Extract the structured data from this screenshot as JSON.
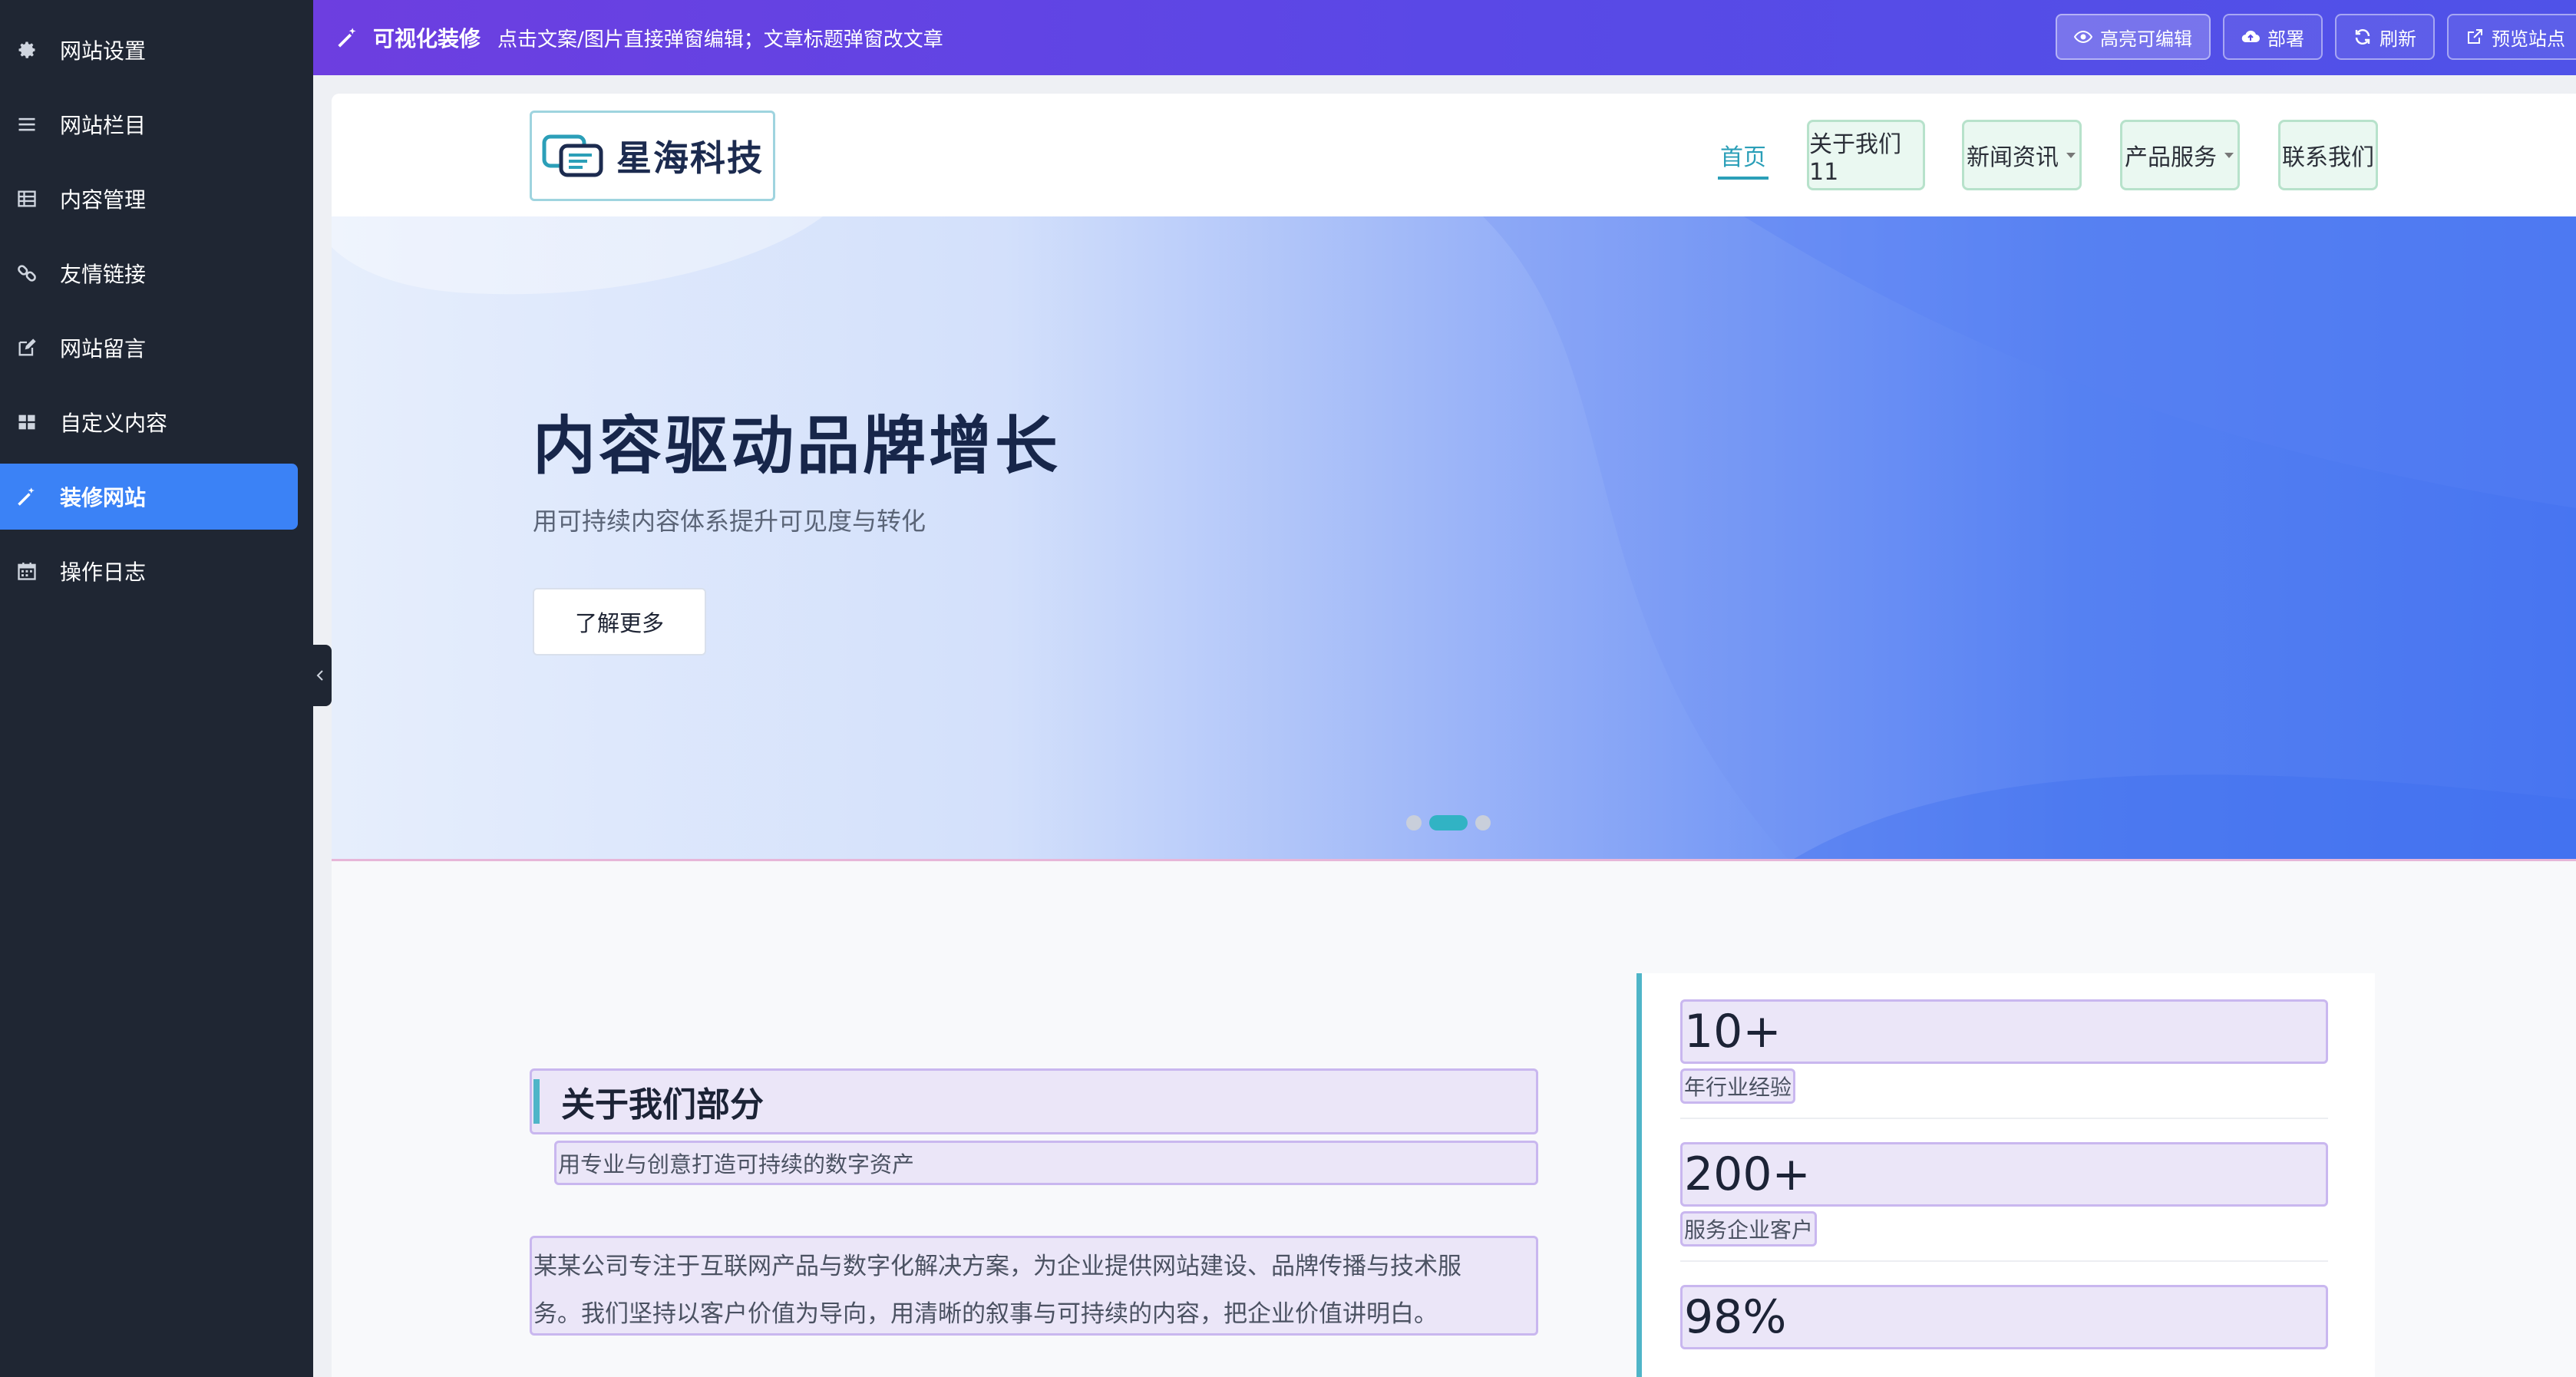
{
  "sidebar": {
    "items": [
      {
        "label": "网站设置",
        "icon": "gear-icon"
      },
      {
        "label": "网站栏目",
        "icon": "list-icon"
      },
      {
        "label": "内容管理",
        "icon": "table-icon"
      },
      {
        "label": "友情链接",
        "icon": "link-icon"
      },
      {
        "label": "网站留言",
        "icon": "edit-icon"
      },
      {
        "label": "自定义内容",
        "icon": "grid-icon"
      },
      {
        "label": "装修网站",
        "icon": "wand-icon",
        "active": true
      },
      {
        "label": "操作日志",
        "icon": "calendar-icon"
      }
    ]
  },
  "toolbar": {
    "title": "可视化装修",
    "hint": "点击文案/图片直接弹窗编辑；文章标题弹窗改文章",
    "highlight_label": "高亮可编辑",
    "deploy_label": "部署",
    "refresh_label": "刷新",
    "preview_label": "预览站点"
  },
  "site": {
    "logo_text": "星海科技",
    "nav": {
      "home": "首页",
      "about": "关于我们11",
      "news": "新闻资讯",
      "products": "产品服务",
      "contact": "联系我们"
    },
    "hero": {
      "title": "内容驱动品牌增长",
      "subtitle": "用可持续内容体系提升可见度与转化",
      "button": "了解更多",
      "slide_count": 3,
      "active_slide": 2
    },
    "about": {
      "title": "关于我们部分",
      "subtitle": "用专业与创意打造可持续的数字资产",
      "desc_line1": "某某公司专注于互联网产品与数字化解决方案，为企业提供网站建设、品牌传播与技术服",
      "desc_line2": "务。我们坚持以客户价值为导向，用清晰的叙事与可持续的内容，把企业价值讲明白。"
    },
    "stats": [
      {
        "value": "10+",
        "label": "年行业经验"
      },
      {
        "value": "200+",
        "label": "服务企业客户"
      },
      {
        "value": "98%",
        "label": ""
      }
    ]
  },
  "colors": {
    "sidebar_bg": "#1f2633",
    "active_item": "#3b82f6",
    "toolbar_gradient_start": "#6d3ee0",
    "accent_teal": "#2b9fb8",
    "editable_highlight": "#ebe6f8"
  }
}
